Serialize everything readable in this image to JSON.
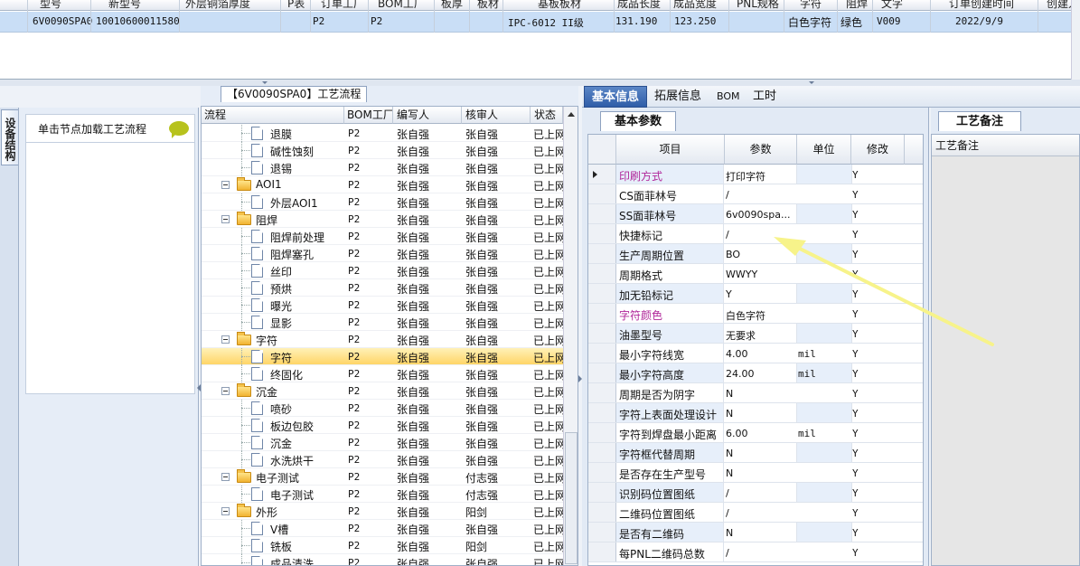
{
  "top_grid": {
    "headers": [
      "型号",
      "新型号",
      "外层铜箔厚度",
      "P表",
      "订单工厂",
      "BOM工厂",
      "板厚",
      "板材",
      "基板板材",
      "成品长度",
      "成品宽度",
      "PNL规格",
      "字符",
      "阻焊",
      "文字",
      "订单创建时间",
      "创建人"
    ],
    "row": {
      "model": "6V0090SPA0",
      "code": "10010600011580",
      "order_factory": "P2",
      "bom_factory": "P2",
      "base_material": "IPC-6012 II级",
      "length": "131.190",
      "width": "123.250",
      "silkscreen": "白色字符",
      "soldermask": "绿色",
      "text": "V009",
      "date": "2022/9/9"
    }
  },
  "left_panel": {
    "side_tab": "设备结构",
    "hint": "单击节点加载工艺流程"
  },
  "process_tree": {
    "title": "【6V0090SPA0】工艺流程",
    "columns": [
      "流程",
      "BOM工厂",
      "编写人",
      "核审人",
      "状态"
    ],
    "rows": [
      {
        "name": "退膜",
        "level": 2,
        "factory": "P2",
        "writer": "张自强",
        "reviewer": "张自强",
        "status": "已上网"
      },
      {
        "name": "碱性蚀刻",
        "level": 2,
        "factory": "P2",
        "writer": "张自强",
        "reviewer": "张自强",
        "status": "已上网"
      },
      {
        "name": "退锡",
        "level": 2,
        "factory": "P2",
        "writer": "张自强",
        "reviewer": "张自强",
        "status": "已上网"
      },
      {
        "name": "AOI1",
        "level": 1,
        "factory": "P2",
        "writer": "张自强",
        "reviewer": "张自强",
        "status": "已上网"
      },
      {
        "name": "外层AOI1",
        "level": 2,
        "factory": "P2",
        "writer": "张自强",
        "reviewer": "张自强",
        "status": "已上网"
      },
      {
        "name": "阻焊",
        "level": 1,
        "factory": "P2",
        "writer": "张自强",
        "reviewer": "张自强",
        "status": "已上网"
      },
      {
        "name": "阻焊前处理",
        "level": 2,
        "factory": "P2",
        "writer": "张自强",
        "reviewer": "张自强",
        "status": "已上网"
      },
      {
        "name": "阻焊塞孔",
        "level": 2,
        "factory": "P2",
        "writer": "张自强",
        "reviewer": "张自强",
        "status": "已上网"
      },
      {
        "name": "丝印",
        "level": 2,
        "factory": "P2",
        "writer": "张自强",
        "reviewer": "张自强",
        "status": "已上网"
      },
      {
        "name": "预烘",
        "level": 2,
        "factory": "P2",
        "writer": "张自强",
        "reviewer": "张自强",
        "status": "已上网"
      },
      {
        "name": "曝光",
        "level": 2,
        "factory": "P2",
        "writer": "张自强",
        "reviewer": "张自强",
        "status": "已上网"
      },
      {
        "name": "显影",
        "level": 2,
        "factory": "P2",
        "writer": "张自强",
        "reviewer": "张自强",
        "status": "已上网"
      },
      {
        "name": "字符",
        "level": 1,
        "factory": "P2",
        "writer": "张自强",
        "reviewer": "张自强",
        "status": "已上网"
      },
      {
        "name": "字符",
        "level": 2,
        "factory": "P2",
        "writer": "张自强",
        "reviewer": "张自强",
        "status": "已上网",
        "selected": true
      },
      {
        "name": "终固化",
        "level": 2,
        "factory": "P2",
        "writer": "张自强",
        "reviewer": "张自强",
        "status": "已上网"
      },
      {
        "name": "沉金",
        "level": 1,
        "factory": "P2",
        "writer": "张自强",
        "reviewer": "张自强",
        "status": "已上网"
      },
      {
        "name": "喷砂",
        "level": 2,
        "factory": "P2",
        "writer": "张自强",
        "reviewer": "张自强",
        "status": "已上网"
      },
      {
        "name": "板边包胶",
        "level": 2,
        "factory": "P2",
        "writer": "张自强",
        "reviewer": "张自强",
        "status": "已上网"
      },
      {
        "name": "沉金",
        "level": 2,
        "factory": "P2",
        "writer": "张自强",
        "reviewer": "张自强",
        "status": "已上网"
      },
      {
        "name": "水洗烘干",
        "level": 2,
        "factory": "P2",
        "writer": "张自强",
        "reviewer": "张自强",
        "status": "已上网"
      },
      {
        "name": "电子测试",
        "level": 1,
        "factory": "P2",
        "writer": "张自强",
        "reviewer": "付志强",
        "status": "已上网"
      },
      {
        "name": "电子测试",
        "level": 2,
        "factory": "P2",
        "writer": "张自强",
        "reviewer": "付志强",
        "status": "已上网"
      },
      {
        "name": "外形",
        "level": 1,
        "factory": "P2",
        "writer": "张自强",
        "reviewer": "阳剑",
        "status": "已上网"
      },
      {
        "name": "V槽",
        "level": 2,
        "factory": "P2",
        "writer": "张自强",
        "reviewer": "张自强",
        "status": "已上网"
      },
      {
        "name": "铣板",
        "level": 2,
        "factory": "P2",
        "writer": "张自强",
        "reviewer": "阳剑",
        "status": "已上网"
      },
      {
        "name": "成品清洗",
        "level": 2,
        "factory": "P2",
        "writer": "张自强",
        "reviewer": "张自强",
        "status": "已上网"
      }
    ]
  },
  "right_tabs": [
    "基本信息",
    "拓展信息",
    "BOM",
    "工时"
  ],
  "params": {
    "tab": "基本参数",
    "columns": [
      "项目",
      "参数",
      "单位",
      "修改"
    ],
    "rows": [
      {
        "name": "印刷方式",
        "value": "打印字符",
        "unit": "",
        "mod": "Y",
        "color": "magenta",
        "current": true
      },
      {
        "name": "CS面菲林号",
        "value": "/",
        "unit": "",
        "mod": "Y"
      },
      {
        "name": "SS面菲林号",
        "value": "6v0090spa...",
        "unit": "",
        "mod": "Y"
      },
      {
        "name": "快捷标记",
        "value": "/",
        "unit": "",
        "mod": "Y"
      },
      {
        "name": "生产周期位置",
        "value": "BO",
        "unit": "",
        "mod": "Y"
      },
      {
        "name": "周期格式",
        "value": "WWYY",
        "unit": "",
        "mod": "Y"
      },
      {
        "name": "加无铅标记",
        "value": "Y",
        "unit": "",
        "mod": "Y"
      },
      {
        "name": "字符颜色",
        "value": "白色字符",
        "unit": "",
        "mod": "Y",
        "color": "magenta"
      },
      {
        "name": "油墨型号",
        "value": "无要求",
        "unit": "",
        "mod": "Y"
      },
      {
        "name": "最小字符线宽",
        "value": "4.00",
        "unit": "mil",
        "mod": "Y"
      },
      {
        "name": "最小字符高度",
        "value": "24.00",
        "unit": "mil",
        "mod": "Y"
      },
      {
        "name": "周期是否为阴字",
        "value": "N",
        "unit": "",
        "mod": "Y"
      },
      {
        "name": "字符上表面处理设计",
        "value": "N",
        "unit": "",
        "mod": "Y"
      },
      {
        "name": "字符到焊盘最小距离",
        "value": "6.00",
        "unit": "mil",
        "mod": "Y"
      },
      {
        "name": "字符框代替周期",
        "value": "N",
        "unit": "",
        "mod": "Y"
      },
      {
        "name": "是否存在生产型号",
        "value": "N",
        "unit": "",
        "mod": "Y"
      },
      {
        "name": "识别码位置图纸",
        "value": "/",
        "unit": "",
        "mod": "Y"
      },
      {
        "name": "二维码位置图纸",
        "value": "/",
        "unit": "",
        "mod": "Y"
      },
      {
        "name": "是否有二维码",
        "value": "N",
        "unit": "",
        "mod": "Y"
      },
      {
        "name": "每PNL二维码总数",
        "value": "/",
        "unit": "",
        "mod": "Y"
      }
    ]
  },
  "notes": {
    "tab": "工艺备注",
    "header": "工艺备注"
  },
  "colors": {
    "selected_row": "#ffd567",
    "active_tab": "#2f5da8",
    "magenta_label": "#b0279a",
    "annotation_arrow": "#f7f38a"
  }
}
